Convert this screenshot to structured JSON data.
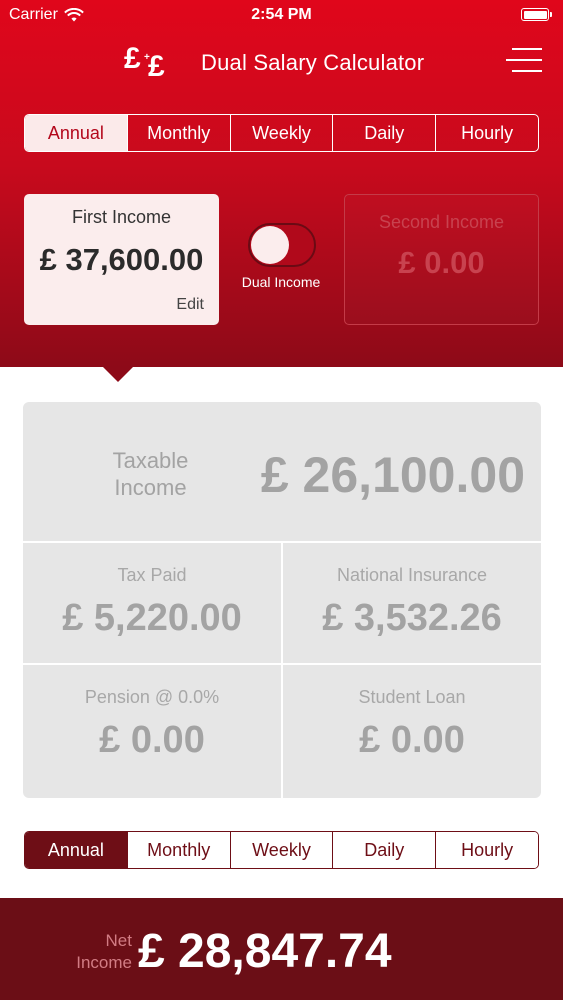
{
  "status_bar": {
    "carrier": "Carrier",
    "time": "2:54 PM"
  },
  "header": {
    "logo_symbol": "£",
    "title": "Dual Salary Calculator",
    "menu_icon": "hamburger-menu-icon"
  },
  "period_tabs_top": {
    "items": [
      "Annual",
      "Monthly",
      "Weekly",
      "Daily",
      "Hourly"
    ],
    "selected": "Annual"
  },
  "first_income": {
    "label": "First Income",
    "amount": "£ 37,600.00",
    "edit_label": "Edit"
  },
  "dual_income_toggle": {
    "label": "Dual Income",
    "state": "off"
  },
  "second_income": {
    "label": "Second Income",
    "amount": "£ 0.00"
  },
  "results": {
    "taxable_income": {
      "label_line1": "Taxable",
      "label_line2": "Income",
      "amount": "£ 26,100.00"
    },
    "tax_paid": {
      "label": "Tax Paid",
      "amount": "£ 5,220.00"
    },
    "national_insurance": {
      "label": "National Insurance",
      "amount": "£ 3,532.26"
    },
    "pension": {
      "label": "Pension @ 0.0%",
      "amount": "£ 0.00"
    },
    "student_loan": {
      "label": "Student Loan",
      "amount": "£ 0.00"
    }
  },
  "period_tabs_bottom": {
    "items": [
      "Annual",
      "Monthly",
      "Weekly",
      "Daily",
      "Hourly"
    ],
    "selected": "Annual"
  },
  "net_income": {
    "label_line1": "Net",
    "label_line2": "Income",
    "amount": "£ 28,847.74"
  },
  "colors": {
    "header_red": "#e0061b",
    "header_dark_red": "#8d0a18",
    "footer_maroon": "#6b0e16",
    "panel_grey": "#e6e6e6"
  }
}
